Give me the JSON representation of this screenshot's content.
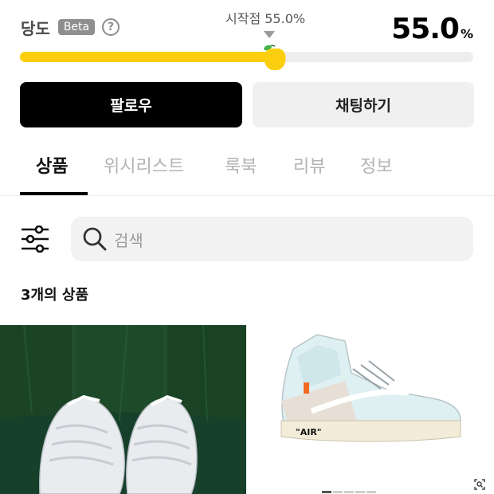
{
  "meter": {
    "label": "당도",
    "badge": "Beta",
    "help_symbol": "?",
    "start_caption": "시작점 55.0%",
    "value_number": "55.0",
    "value_unit": "%",
    "level_percent": 55.0,
    "colors": {
      "fill": "#fbcf0f",
      "track": "#eeeeee"
    },
    "marker_icon": "yellow-fruit-icon"
  },
  "actions": {
    "follow_label": "팔로우",
    "chat_label": "채팅하기"
  },
  "tabs": [
    {
      "label": "상품",
      "active": true
    },
    {
      "label": "위시리스트",
      "active": false
    },
    {
      "label": "룩북",
      "active": false
    },
    {
      "label": "리뷰",
      "active": false
    },
    {
      "label": "정보",
      "active": false
    }
  ],
  "search": {
    "placeholder": "검색",
    "filter_icon": "filter-sliders-icon",
    "search_icon": "magnifier-icon"
  },
  "products": {
    "count_label": "3개의 상품",
    "items": [
      {
        "image": "white-chunky-sneakers-on-green-velvet"
      },
      {
        "image": "white-high-top-sneaker",
        "print": "\"AIR\""
      }
    ]
  }
}
